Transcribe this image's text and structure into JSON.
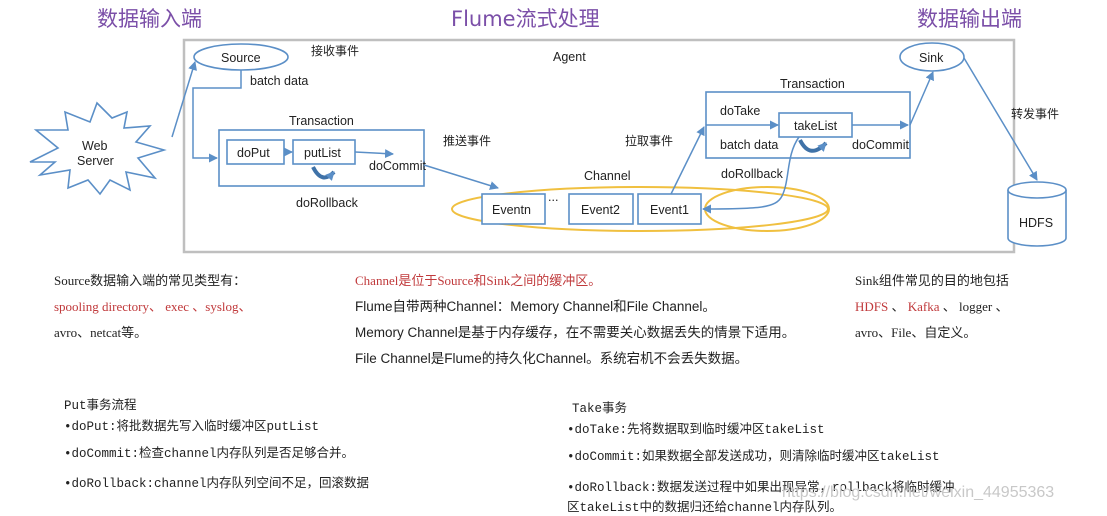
{
  "headings": {
    "input_end": "数据输入端",
    "flume_process": "Flume流式处理",
    "output_end": "数据输出端"
  },
  "diagram": {
    "agent_label": "Agent",
    "web_server_line1": "Web",
    "web_server_line2": "Server",
    "source_label": "Source",
    "receive_event": "接收事件",
    "batch_data_source": "batch data",
    "put_transaction": {
      "title": "Transaction",
      "do_put": "doPut",
      "put_list": "putList",
      "do_commit": "doCommit",
      "do_rollback": "doRollback"
    },
    "push_event": "推送事件",
    "pull_event": "拉取事件",
    "channel": {
      "label": "Channel",
      "events": [
        "Eventn",
        "...",
        "Event2",
        "Event1"
      ]
    },
    "take_transaction": {
      "title": "Transaction",
      "do_take": "doTake",
      "batch_data": "batch data",
      "take_list": "takeList",
      "do_commit": "doCommit",
      "do_rollback": "doRollback"
    },
    "sink_label": "Sink",
    "forward_event": "转发事件",
    "hdfs_label": "HDFS",
    "colors": {
      "heading": "#7b4fa8",
      "box_stroke": "#5b8fc7",
      "agent_border": "#bfbfbf",
      "channel_ellipse": "#f0c040",
      "highlight_red": "#c0393b"
    }
  },
  "notes": {
    "source": {
      "title": "Source数据输入端的常见类型有：",
      "red_line": "spooling directory、 exec 、syslog、",
      "line3": "avro、netcat等。"
    },
    "channel": {
      "red_line": "Channel是位于Source和Sink之间的缓冲区。",
      "line2": "Flume自带两种Channel：Memory Channel和File Channel。",
      "line3": "Memory Channel是基于内存缓存，在不需要关心数据丢失的情景下适用。",
      "line4": "File Channel是Flume的持久化Channel。系统宕机不会丢失数据。"
    },
    "sink": {
      "title": "Sink组件常见的目的地包括",
      "red_hdfs": "HDFS",
      "sep1": " 、 ",
      "red_kafka": "Kafka",
      "rest_line2": " 、 logger 、",
      "line3": "avro、File、自定义。"
    },
    "put": {
      "title": "Put事务流程",
      "items": [
        "•doPut:将批数据先写入临时缓冲区putList",
        "•doCommit:检查channel内存队列是否足够合并。",
        "•doRollback:channel内存队列空间不足，回滚数据"
      ]
    },
    "take": {
      "title": "Take事务",
      "items": [
        "•doTake:先将数据取到临时缓冲区takeList",
        "•doCommit:如果数据全部发送成功，则清除临时缓冲区takeList",
        "•doRollback:数据发送过程中如果出现异常，rollback将临时缓冲",
        "区takeList中的数据归还给channel内存队列。"
      ]
    }
  },
  "watermark": "https://blog.csdn.net/weixin_44955363"
}
